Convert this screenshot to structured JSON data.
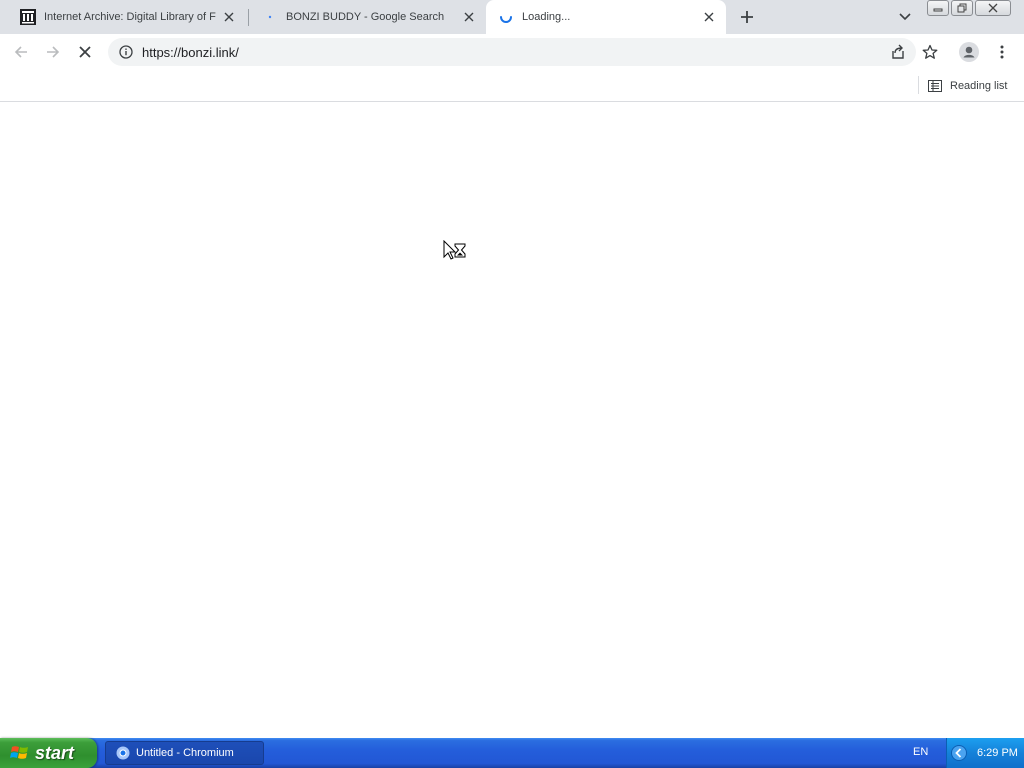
{
  "browser": {
    "tabs": [
      {
        "title": "Internet Archive: Digital Library of F",
        "favicon": "archive-building-icon",
        "active": false
      },
      {
        "title": "BONZI BUDDY - Google Search",
        "favicon": "google-dot-icon",
        "active": false
      },
      {
        "title": "Loading...",
        "favicon": "loading-spinner-icon",
        "active": true
      }
    ],
    "address_bar": {
      "url": "https://bonzi.link/"
    },
    "bookmarks_bar": {
      "reading_list_label": "Reading list"
    }
  },
  "taskbar": {
    "start_label": "start",
    "task_label": "Untitled - Chromium",
    "language": "EN",
    "clock": "6:29 PM"
  },
  "colors": {
    "tabstrip": "#dee1e6",
    "taskbar_blue": "#245edb",
    "start_green": "#3c9e3a",
    "tray_blue": "#1581d9",
    "spinner": "#1a73e8"
  }
}
